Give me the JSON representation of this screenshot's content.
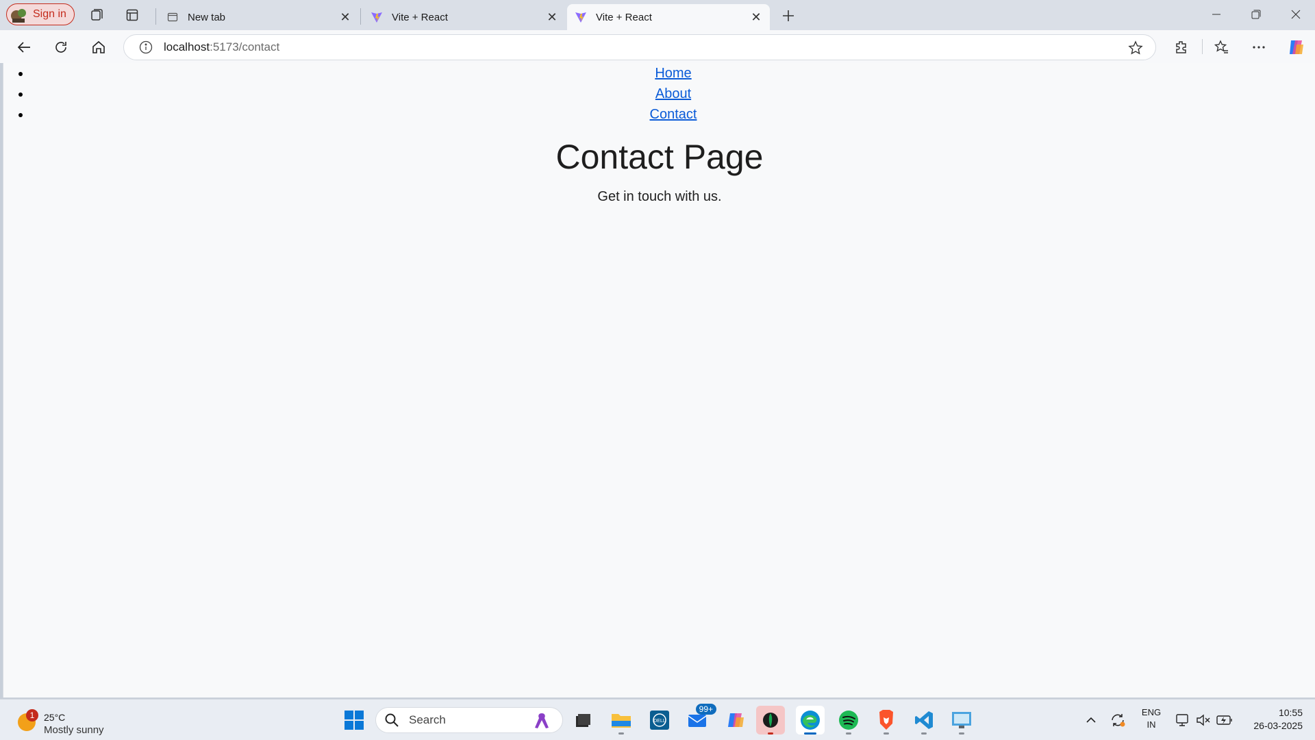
{
  "browser": {
    "signin_label": "Sign in",
    "tabs": [
      {
        "title": "New tab",
        "favicon": "new-tab-icon",
        "active": false
      },
      {
        "title": "Vite + React",
        "favicon": "vite-icon",
        "active": false
      },
      {
        "title": "Vite + React",
        "favicon": "vite-icon",
        "active": true
      }
    ],
    "address": {
      "host": "localhost",
      "path": ":5173/contact"
    }
  },
  "page": {
    "nav": [
      "Home",
      "About",
      "Contact"
    ],
    "title": "Contact Page",
    "subtitle": "Get in touch with us."
  },
  "taskbar": {
    "weather": {
      "badge": "1",
      "temp": "25°C",
      "condition": "Mostly sunny"
    },
    "search_placeholder": "Search",
    "mail_badge": "99+",
    "apps": [
      "windows-start-icon",
      "search",
      "file-explorer-icon",
      "file-folder-icon",
      "dell-icon",
      "mail-icon",
      "copilot-icon",
      "mongodb-compass-icon",
      "edge-icon",
      "spotify-icon",
      "brave-icon",
      "vscode-icon",
      "remote-desktop-icon"
    ],
    "language": {
      "line1": "ENG",
      "line2": "IN"
    },
    "time": "10:55",
    "date": "26-03-2025"
  },
  "colors": {
    "accent": "#0067c0",
    "link": "#0a5bd8",
    "signin_border": "#c42b1c"
  }
}
